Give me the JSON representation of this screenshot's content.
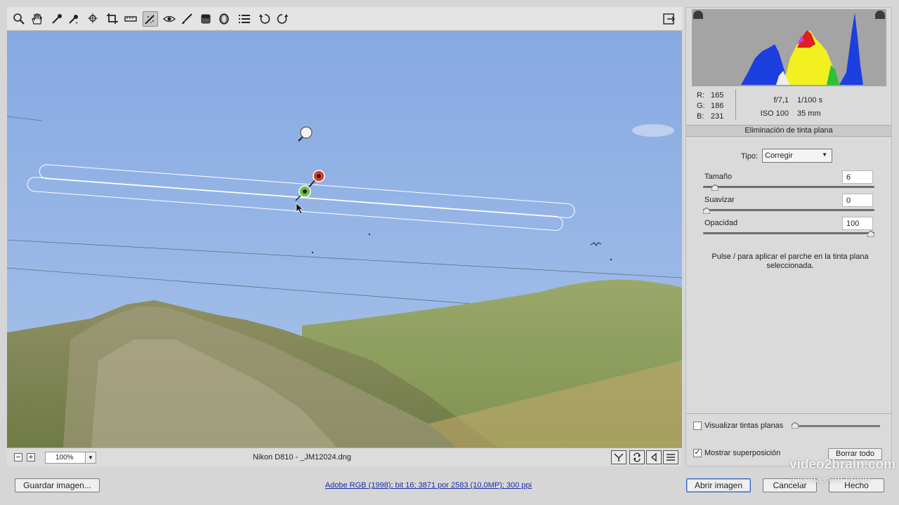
{
  "toolbar": {
    "tools": [
      {
        "name": "zoom-tool-icon"
      },
      {
        "name": "hand-tool-icon"
      },
      {
        "name": "white-balance-tool-icon"
      },
      {
        "name": "color-sampler-tool-icon"
      },
      {
        "name": "targeted-adjustment-tool-icon"
      },
      {
        "name": "crop-tool-icon"
      },
      {
        "name": "straighten-tool-icon"
      },
      {
        "name": "spot-removal-tool-icon",
        "active": true
      },
      {
        "name": "red-eye-removal-tool-icon"
      },
      {
        "name": "adjustment-brush-icon"
      },
      {
        "name": "graduated-filter-icon"
      },
      {
        "name": "radial-filter-icon"
      },
      {
        "name": "preferences-icon"
      },
      {
        "name": "rotate-left-icon"
      },
      {
        "name": "rotate-right-icon"
      }
    ],
    "fullscreen_icon": "fullscreen-toggle-icon"
  },
  "statusbar": {
    "zoom_out": "−",
    "zoom_in": "+",
    "zoom_value": "100%",
    "filename": "Nikon D810 -  _JM12024.dng"
  },
  "info": {
    "r_label": "R:",
    "r_value": "165",
    "g_label": "G:",
    "g_value": "186",
    "b_label": "B:",
    "b_value": "231",
    "aperture": "f/7,1",
    "shutter": "1/100 s",
    "iso": "ISO 100",
    "focal": "35 mm"
  },
  "panel": {
    "title": "Eliminación de tinta plana",
    "tipo_label": "Tipo:",
    "tipo_value": "Corregir",
    "sliders": [
      {
        "label": "Tamaño",
        "value": "6",
        "fraction": 0.05
      },
      {
        "label": "Suavizar",
        "value": "0",
        "fraction": 0.0
      },
      {
        "label": "Opacidad",
        "value": "100",
        "fraction": 1.0
      }
    ],
    "hint": "Pulse / para aplicar el parche en la tinta plana seleccionada.",
    "visualize_label": "Visualizar tintas planas",
    "visualize_checked": false,
    "overlay_label": "Mostrar superposición",
    "overlay_checked": true,
    "clear_all": "Borrar todo"
  },
  "bottom": {
    "save": "Guardar imagen...",
    "workflow": "Adobe RGB (1998); bit 16; 3871 por 2583 (10,0MP); 300 ppi",
    "open": "Abrir imagen",
    "cancel": "Cancelar",
    "done": "Hecho"
  },
  "watermark": {
    "line1": "video2brain.com",
    "line2": "a lynda.com brand"
  },
  "colors": {
    "sky": "#8fb0e3",
    "accent_blue": "#2b62c4",
    "link": "#1a2fa8"
  }
}
